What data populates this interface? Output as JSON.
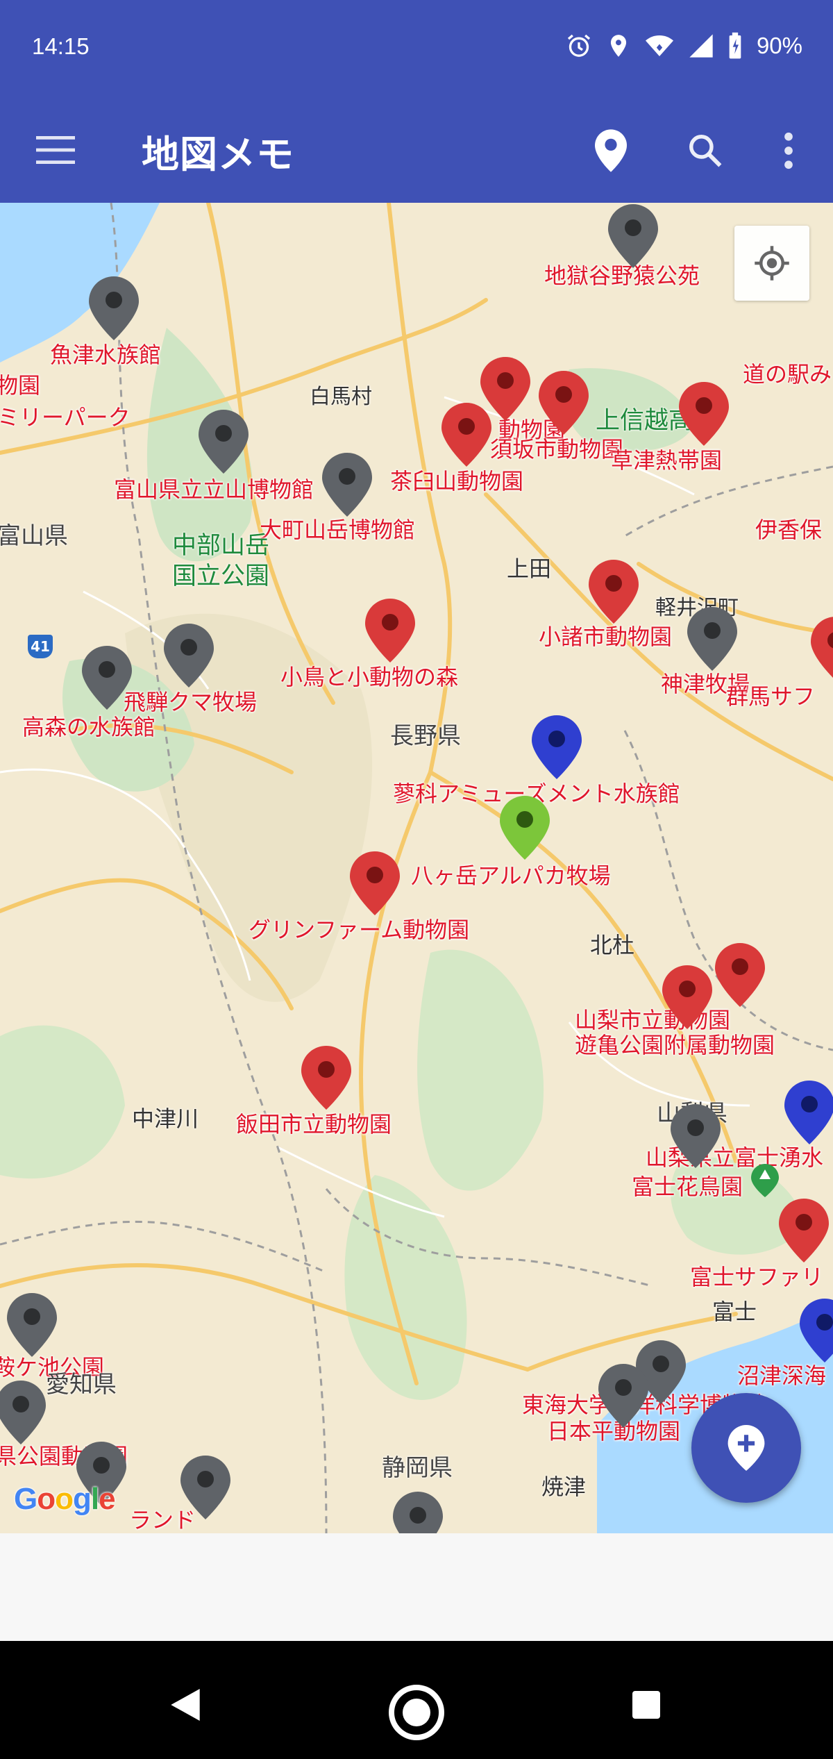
{
  "status_bar": {
    "time": "14:15",
    "battery": "90%",
    "icons": [
      "alarm-icon",
      "location-icon",
      "wifi-icon",
      "signal-icon",
      "battery-icon"
    ]
  },
  "app_bar": {
    "title": "地図メモ",
    "icons": [
      "menu-icon",
      "map-pin-icon",
      "search-icon",
      "more-vert-icon"
    ]
  },
  "map": {
    "poi_labels": [
      "地獄谷野猿公苑",
      "魚津水族館",
      "道の駅み",
      "物園",
      "ミリーパーク",
      "白馬村",
      "動物園",
      "須坂市動物園",
      "上信越高原",
      "草津熱帯園",
      "富山県立立山博物館",
      "茶臼山動物園",
      "大町山岳博物館",
      "伊香保",
      "富山県",
      "上田",
      "軽井沢町",
      "小諸市動物園",
      "神津牧場",
      "群馬サフ",
      "飛騨クマ牧場",
      "小鳥と小動物の森",
      "高森の水族館",
      "長野県",
      "蓼科アミューズメント水族館",
      "八ヶ岳アルパカ牧場",
      "グリンファーム動物園",
      "北杜",
      "山梨市立動物園",
      "遊亀公園附属動物園",
      "中津川",
      "飯田市立動物園",
      "山梨県",
      "山梨県立富士湧水",
      "富士花鳥園",
      "富士サファリ",
      "富士",
      "鞍ケ池公園",
      "愛知県",
      "東海大学海洋科学博物館",
      "日本平動物園",
      "沼津深海",
      "県公園動物園",
      "静岡県",
      "焼津",
      "ランド",
      "中部山岳",
      "国立公園",
      "41"
    ],
    "markers": [
      "gray",
      "gray",
      "red",
      "red",
      "red",
      "red",
      "gray",
      "gray",
      "red",
      "red",
      "gray",
      "gray",
      "gray",
      "red",
      "blue",
      "green",
      "red",
      "red",
      "red",
      "red",
      "gray",
      "blue",
      "red",
      "blue",
      "gray",
      "gray",
      "gray",
      "gray",
      "gray",
      "gray",
      "gray"
    ],
    "locate_icon": "my-location-icon",
    "attribution": "Google"
  },
  "fab": {
    "icon": "add-location-icon"
  },
  "nav_bar": {
    "icons": [
      "back-icon",
      "home-icon",
      "recents-icon"
    ]
  }
}
